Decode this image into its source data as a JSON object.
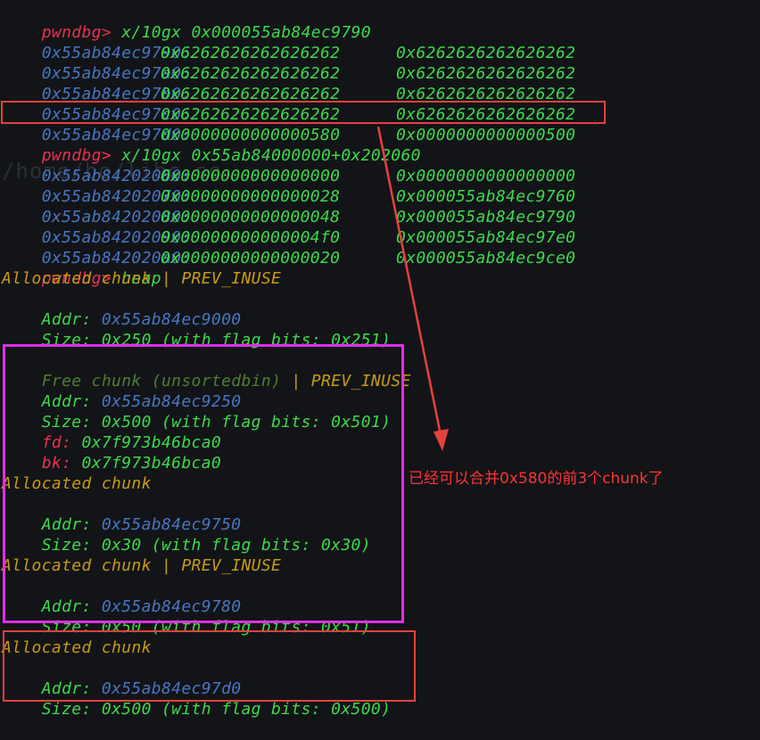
{
  "commands": [
    {
      "prompt": "pwndbg>",
      "text": "x/10gx 0x000055ab84ec9790"
    },
    {
      "prompt": "pwndbg>",
      "text": "x/10gx 0x55ab84000000+0x202060"
    },
    {
      "prompt": "pwndbg>",
      "text": "heap"
    }
  ],
  "dump1": [
    {
      "addr": "0x55ab84ec9790:",
      "v1": "0x6262626262626262",
      "v2": "0x6262626262626262"
    },
    {
      "addr": "0x55ab84ec97a0:",
      "v1": "0x6262626262626262",
      "v2": "0x6262626262626262"
    },
    {
      "addr": "0x55ab84ec97b0:",
      "v1": "0x6262626262626262",
      "v2": "0x6262626262626262"
    },
    {
      "addr": "0x55ab84ec97c0:",
      "v1": "0x6262626262626262",
      "v2": "0x6262626262626262"
    },
    {
      "addr": "0x55ab84ec97d0:",
      "v1": "0x0000000000000580",
      "v2": "0x0000000000000500"
    }
  ],
  "dump2": [
    {
      "addr": "0x55ab84202060:",
      "v1": "0x0000000000000000",
      "v2": "0x0000000000000000"
    },
    {
      "addr": "0x55ab84202070:",
      "v1": "0x0000000000000028",
      "v2": "0x000055ab84ec9760"
    },
    {
      "addr": "0x55ab84202080:",
      "v1": "0x0000000000000048",
      "v2": "0x000055ab84ec9790"
    },
    {
      "addr": "0x55ab84202090:",
      "v1": "0x00000000000004f0",
      "v2": "0x000055ab84ec97e0"
    },
    {
      "addr": "0x55ab842020a0:",
      "v1": "0x0000000000000020",
      "v2": "0x000055ab84ec9ce0"
    }
  ],
  "ghost_text": "/home/bo/libc.so",
  "chunk_labels": {
    "allocated": "Allocated chunk",
    "allocated_prev": "Allocated chunk | PREV_INUSE",
    "free_prefix": "Free chunk (unsortedbin)",
    "free_suffix": " | PREV_INUSE",
    "addr_key": "Addr:",
    "size_key": "Size:",
    "fd_key": "fd:",
    "bk_key": "bk:"
  },
  "chunks": {
    "c0": {
      "addr": "0x55ab84ec9000",
      "size": "0x250 (with flag bits: 0x251)"
    },
    "c1": {
      "addr": "0x55ab84ec9250",
      "size": "0x500 (with flag bits: 0x501)",
      "fd": "0x7f973b46bca0",
      "bk": "0x7f973b46bca0"
    },
    "c2": {
      "addr": "0x55ab84ec9750",
      "size": "0x30 (with flag bits: 0x30)"
    },
    "c3": {
      "addr": "0x55ab84ec9780",
      "size": "0x50 (with flag bits: 0x51)"
    },
    "c4": {
      "addr": "0x55ab84ec97d0",
      "size": "0x500 (with flag bits: 0x500)"
    }
  },
  "annotation": "已经可以合并0x580的前3个chunk了",
  "colors": {
    "background": "#121418",
    "prompt": "#e8324d",
    "value": "#3ed94a",
    "address": "#4876c0",
    "label": "#c99a12",
    "box_red": "#e5413c",
    "box_magenta": "#e22ee6",
    "arrow": "#e5413c"
  }
}
